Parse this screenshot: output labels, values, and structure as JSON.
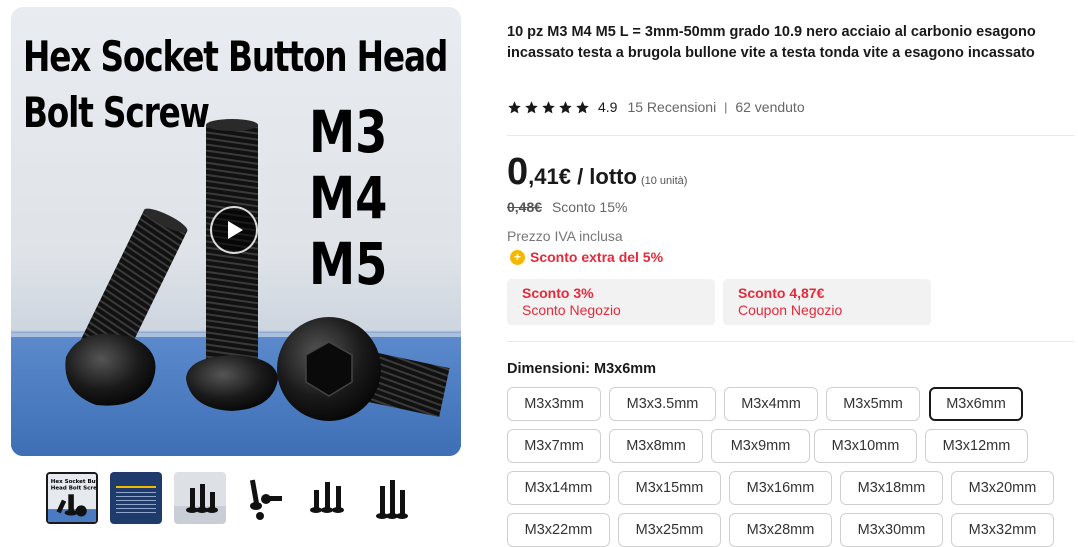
{
  "gallery": {
    "image_text": {
      "title_line1": "Hex Socket Button Head",
      "title_line2": "Bolt Screw",
      "sizes": [
        "M3",
        "M4",
        "M5"
      ]
    },
    "thumbnails": [
      {
        "name": "thumb-1",
        "active": true,
        "text": "Hex Socket Button Head Bolt Screw"
      },
      {
        "name": "thumb-2",
        "active": false
      },
      {
        "name": "thumb-3",
        "active": false
      },
      {
        "name": "thumb-4",
        "active": false
      },
      {
        "name": "thumb-5",
        "active": false
      },
      {
        "name": "thumb-6",
        "active": false
      }
    ]
  },
  "product": {
    "title": "10 pz M3 M4 M5 L = 3mm-50mm grado 10.9 nero acciaio al carbonio esagono incassato testa a brugola bullone vite a testa tonda vite a esagono incassato",
    "rating": {
      "score": "4.9",
      "reviews": "15 Recensioni",
      "sold": "62 venduto",
      "stars": 5
    },
    "price": {
      "int": "0",
      "decimal": ",41€ / lotto",
      "unit": "(10 unità)",
      "old": "0,48€",
      "discount": "Sconto 15%",
      "vat": "Prezzo IVA inclusa",
      "extra": "Sconto extra del 5%"
    },
    "coupons": [
      {
        "top": "Sconto 3%",
        "bottom": "Sconto Negozio"
      },
      {
        "top": "Sconto 4,87€",
        "bottom": "Coupon Negozio"
      }
    ],
    "dimension_label": "Dimensioni: M3x6mm",
    "dimensions": [
      [
        "M3x3mm",
        "M3x3.5mm",
        "M3x4mm",
        "M3x5mm",
        "M3x6mm"
      ],
      [
        "M3x7mm",
        "M3x8mm",
        "M3x9mm",
        "M3x10mm",
        "M3x12mm"
      ],
      [
        "M3x14mm",
        "M3x15mm",
        "M3x16mm",
        "M3x18mm",
        "M3x20mm"
      ],
      [
        "M3x22mm",
        "M3x25mm",
        "M3x28mm",
        "M3x30mm",
        "M3x32mm"
      ]
    ],
    "selected_dimension": "M3x6mm"
  },
  "colors": {
    "accent_red": "#e5293a",
    "text": "#191919",
    "star": "#191919",
    "coin": "#f5b800"
  }
}
